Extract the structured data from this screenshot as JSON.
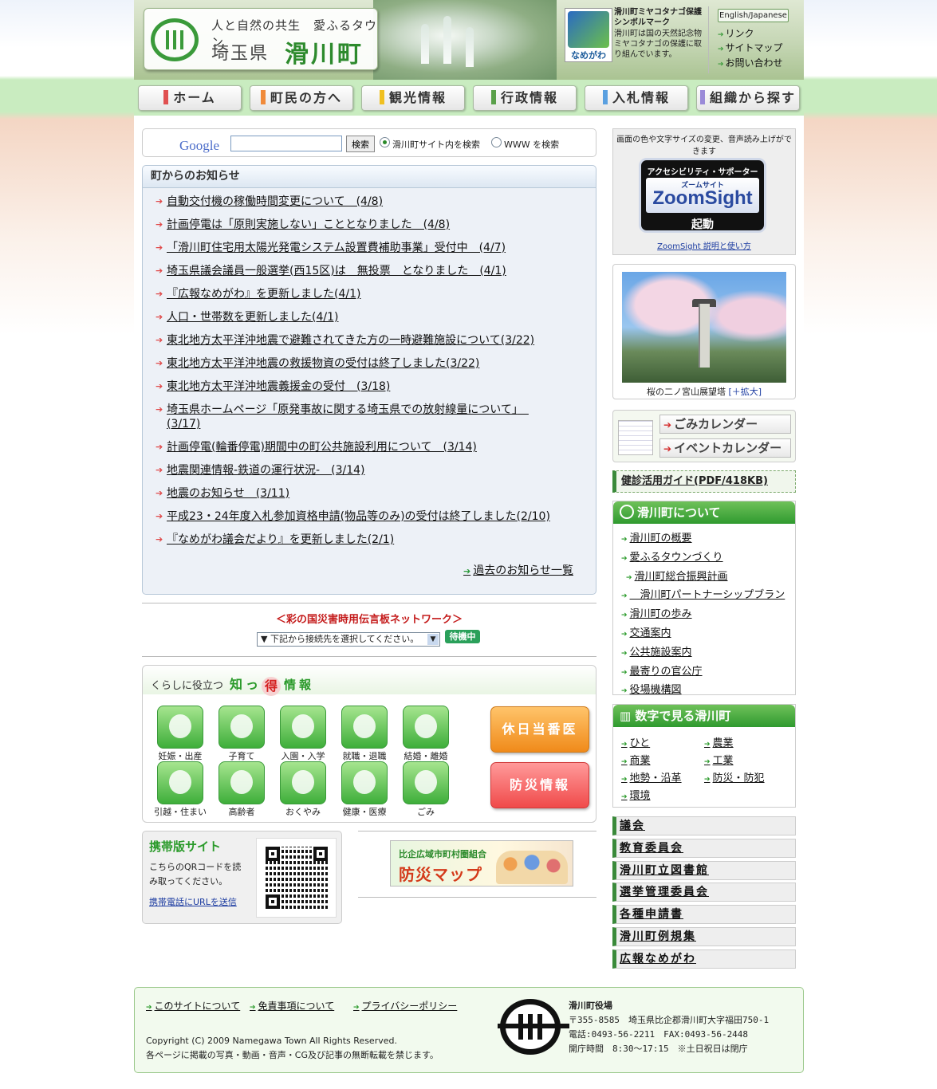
{
  "header": {
    "logo_subtitle": "人と自然の共生　愛ふるタウン",
    "logo_pref": "埼玉県",
    "logo_town": "滑川町",
    "symbol_label": "なめがわ",
    "symbol_title": "滑川町ミヤコタナゴ保護シンボルマーク",
    "symbol_desc": "滑川町は国の天然記念物ミヤコタナゴの保護に取り組んでいます。",
    "lang_button": "English/Japanese",
    "links": [
      "リンク",
      "サイトマップ",
      "お問い合わせ"
    ]
  },
  "nav": {
    "items": [
      {
        "label": "ホーム",
        "color": "#e05050"
      },
      {
        "label": "町民の方へ",
        "color": "#f08a3a"
      },
      {
        "label": "観光情報",
        "color": "#f0c020"
      },
      {
        "label": "行政情報",
        "color": "#5aa04a"
      },
      {
        "label": "入札情報",
        "color": "#5aa0e0"
      },
      {
        "label": "組織から探す",
        "color": "#9a8ad8"
      }
    ]
  },
  "search": {
    "logo": "Google",
    "button": "検索",
    "opt_site": "滑川町サイト内を検索",
    "opt_www": "WWW を検索"
  },
  "news": {
    "title": "町からのお知らせ",
    "items": [
      "自動交付機の稼働時間変更について　(4/8)",
      "計画停電は「原則実施しない」こととなりました　(4/8)",
      "「滑川町住宅用太陽光発電システム設置費補助事業」受付中　(4/7)",
      "埼玉県議会議員一般選挙(西15区)は　無投票　となりました　(4/1)",
      "『広報なめがわ』を更新しました(4/1)",
      "人口・世帯数を更新しました(4/1)",
      "東北地方太平洋沖地震で避難されてきた方の一時避難施設について(3/22)",
      "東北地方太平洋沖地震の救援物資の受付は終了しました(3/22)",
      "東北地方太平洋沖地震義援金の受付　(3/18)",
      "埼玉県ホームページ「原発事故に関する埼玉県での放射線量について」　(3/17)",
      "計画停電(輪番停電)期間中の町公共施設利用について　(3/14)",
      "地震関連情報-鉄道の運行状況-　(3/14)",
      "地震のお知らせ　(3/11)",
      "平成23・24年度入札参加資格申請(物品等のみ)の受付は終了しました(2/10)",
      "『なめがわ議会だより』を更新しました(2/1)"
    ],
    "past_link": "過去のお知らせ一覧"
  },
  "disaster": {
    "title": "＜彩の国災害時用伝言板ネットワーク＞",
    "select_placeholder": "▼ 下記から接続先を選択してください。",
    "status": "待機中"
  },
  "info": {
    "head_prefix": "くらしに役立つ",
    "head_1": "知っ",
    "head_2": "得",
    "head_3": "情報",
    "categories": [
      "妊娠・出産",
      "子育て",
      "入園・入学",
      "就職・退職",
      "結婚・離婚",
      "引越・住まい",
      "高齢者",
      "おくやみ",
      "健康・医療",
      "ごみ"
    ],
    "holiday_doctor": "休日当番医",
    "disaster_info": "防災情報"
  },
  "mobile": {
    "title": "携帯版サイト",
    "desc": "こちらのQRコードを読み取ってください。",
    "link": "携帯電話にURLを送信"
  },
  "banner": {
    "line1": "比企広域市町村圏組合",
    "line2": "防災マップ"
  },
  "zoom": {
    "desc": "画面の色や文字サイズの変更、音声読み上げができます",
    "b1": "アクセシビリティ・サポーター",
    "b2": "ズームサイト",
    "b3": "ZoomSight",
    "b4": "起動",
    "help": "ZoomSight 説明と使い方"
  },
  "photo": {
    "caption": "桜の二ノ宮山展望塔",
    "enlarge": "[＋拡大]"
  },
  "calendar": {
    "garbage": "ごみカレンダー",
    "event": "イベントカレンダー"
  },
  "guide": "健診活用ガイド(PDF/418KB)",
  "about": {
    "title": "滑川町について",
    "items": [
      "滑川町の概要",
      "愛ふるタウンづくり",
      "滑川町総合振興計画",
      "　滑川町パートナーシップブラン",
      "滑川町の歩み",
      "交通案内",
      "公共施設案内",
      "最寄りの官公庁",
      "役場機構図"
    ]
  },
  "stats": {
    "title": "数字で見る滑川町",
    "left": [
      "ひと",
      "商業",
      "地勢・沿革",
      "環境"
    ],
    "right": [
      "農業",
      "工業",
      "防災・防犯"
    ]
  },
  "side_links": [
    "議会",
    "教育委員会",
    "滑川町立図書館",
    "選挙管理委員会",
    "各種申請書",
    "滑川町例規集",
    "広報なめがわ"
  ],
  "footer": {
    "links": [
      "このサイトについて",
      "免責事項について",
      "プライバシーポリシー"
    ],
    "copyright": "Copyright (C) 2009 Namegawa Town All Rights Reserved.",
    "notice": "各ページに掲載の写真・動画・音声・CG及び記事の無断転載を禁じます。",
    "office": "滑川町役場",
    "address": "〒355-8585　埼玉県比企郡滑川町大字福田750-1",
    "tel": "電話:0493-56-2211　FAX:0493-56-2448",
    "hours": "開庁時間　8:30～17:15　※土日祝日は閉庁"
  }
}
